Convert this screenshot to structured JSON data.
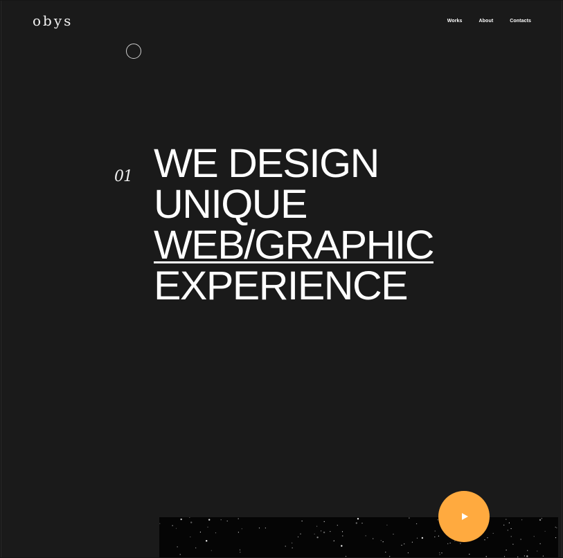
{
  "header": {
    "logo": "obys",
    "nav": [
      {
        "label": "Works"
      },
      {
        "label": "About"
      },
      {
        "label": "Contacts"
      }
    ]
  },
  "hero": {
    "index": "01",
    "lines": [
      "WE DESIGN",
      "UNIQUE",
      "WEB/GRAPHIC",
      "EXPERIENCE"
    ],
    "underlined_line": "WEB/GRAPHIC"
  },
  "video": {
    "play_icon": "play-icon",
    "play_color": "#ffaa3f"
  },
  "colors": {
    "background": "#1a1a1a",
    "text": "#ffffff",
    "accent": "#ffaa3f"
  }
}
